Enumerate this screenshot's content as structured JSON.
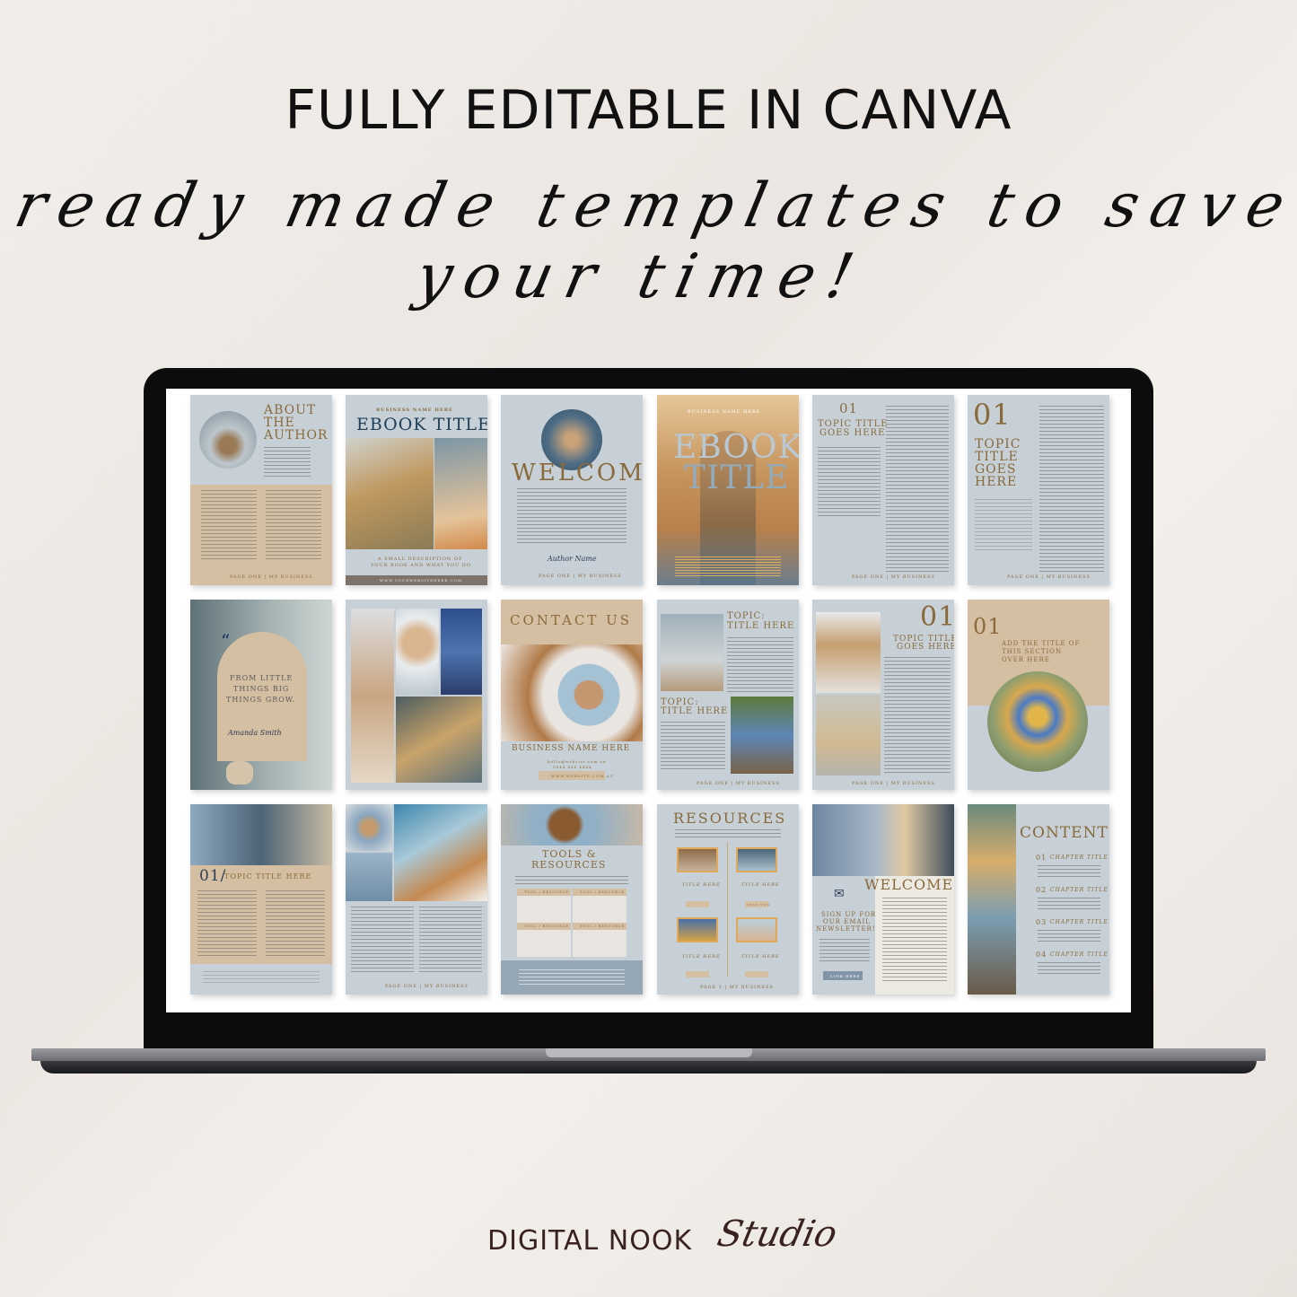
{
  "header": {
    "title": "FULLY EDITABLE IN CANVA",
    "subtitle": "ready made templates to save your time!"
  },
  "brand": {
    "name": "DIGITAL NOOK",
    "script": "Studio"
  },
  "colors": {
    "page_blue": "#c6d0d6",
    "page_tan": "#d5bfa3",
    "gold_text": "#8a6a3a",
    "navy": "#2c3e55"
  },
  "pages": {
    "about": {
      "title1": "ABOUT",
      "title2": "THE",
      "title3": "AUTHOR",
      "footer": "PAGE ONE | MY BUSINESS"
    },
    "cover1": {
      "business": "BUSINESS NAME HERE",
      "title": "EBOOK TITLE",
      "desc1": "A SMALL DESCRIPTION OF",
      "desc2": "YOUR BOOK AND WHAT YOU DO",
      "url": "WWW.YOURWEBSITEHERE.COM"
    },
    "welcome": {
      "title": "WELCOME",
      "signature": "Author Name",
      "footer": "PAGE ONE | MY BUSINESS"
    },
    "cover2": {
      "business": "BUSINESS NAME HERE",
      "title1": "EBOOK",
      "title2": "TITLE"
    },
    "topic1": {
      "number": "01",
      "title1": "TOPIC TITLE",
      "title2": "GOES HERE",
      "footer": "PAGE ONE | MY BUSINESS"
    },
    "topic2": {
      "number": "01",
      "title1": "TOPIC",
      "title2": "TITLE",
      "title3": "GOES",
      "title4": "HERE",
      "footer": "PAGE ONE | MY BUSINESS"
    },
    "quote": {
      "line1": "FROM LITTLE",
      "line2": "THINGS BIG",
      "line3": "THINGS GROW.",
      "signature": "Amanda Smith"
    },
    "contact": {
      "title": "CONTACT US",
      "business": "BUSINESS NAME HERE",
      "email": "hello@website.com.au",
      "phone": "0444 444 4444",
      "button": "WWW.WEBSITE.COM.AU"
    },
    "topics": {
      "title1a": "TOPIC:",
      "title1b": "TITLE HERE",
      "title2a": "TOPIC:",
      "title2b": "TITLE HERE",
      "footer": "PAGE ONE | MY BUSINESS"
    },
    "topic3": {
      "number": "01",
      "title1": "TOPIC TITLE",
      "title2": "GOES HERE",
      "footer": "PAGE ONE | MY BUSINESS"
    },
    "section": {
      "number": "01",
      "line1": "ADD THE TITLE OF",
      "line2": "THIS SECTION",
      "line3": "OVER HERE"
    },
    "topic4": {
      "number": "01/",
      "title": "TOPIC TITLE HERE"
    },
    "collage": {
      "footer": "PAGE ONE | MY BUSINESS"
    },
    "tools": {
      "title1": "TOOLS &",
      "title2": "RESOURCES",
      "cells": [
        "TOOL / RESOURCE",
        "TOOL / RESOURCE",
        "TOOL / RESOURCE",
        "TOOL / RESOURCE"
      ]
    },
    "resources": {
      "title": "RESOURCES",
      "items": [
        "TITLE HERE",
        "TITLE HERE",
        "TITLE HERE",
        "TITLE HERE"
      ],
      "button": "SHOP NOW",
      "footer": "PAGE 1 | MY BUSINESS"
    },
    "newsletter": {
      "title": "WELCOME",
      "signup1": "SIGN UP FOR",
      "signup2": "OUR EMAIL",
      "signup3": "NEWSLETTER!",
      "button": "LINK HERE"
    },
    "contents": {
      "title": "CONTENTS",
      "items": [
        {
          "num": "01",
          "label": "CHAPTER TITLE"
        },
        {
          "num": "02",
          "label": "CHAPTER TITLE"
        },
        {
          "num": "03",
          "label": "CHAPTER TITLE"
        },
        {
          "num": "04",
          "label": "CHAPTER TITLE"
        }
      ]
    }
  }
}
